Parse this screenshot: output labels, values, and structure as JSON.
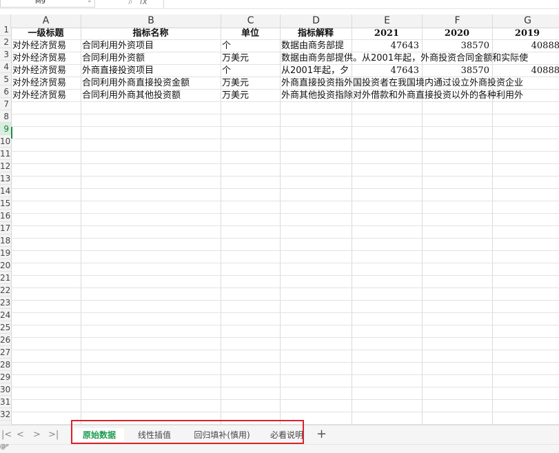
{
  "toolbar": {
    "cell_ref": "M9",
    "search_icon": "🔍",
    "fx_label": "fx"
  },
  "columns": [
    {
      "label": "A"
    },
    {
      "label": "B"
    },
    {
      "label": "C"
    },
    {
      "label": "D"
    },
    {
      "label": "E"
    },
    {
      "label": "F"
    },
    {
      "label": "G"
    }
  ],
  "rows": [
    "1",
    "2",
    "3",
    "4",
    "5",
    "6",
    "7",
    "8",
    "9",
    "10",
    "11",
    "12",
    "13",
    "14",
    "15",
    "16",
    "17",
    "18",
    "19",
    "20",
    "21",
    "22",
    "23",
    "24",
    "25",
    "26",
    "27",
    "28",
    "29",
    "30",
    "31",
    "32"
  ],
  "table": {
    "header": [
      "一级标题",
      "指标名称",
      "单位",
      "指标解释",
      "2021",
      "2020",
      "2019"
    ],
    "data": [
      [
        "对外经济贸易",
        "合同利用外资项目",
        "个",
        "数据由商务部提",
        "47643",
        "38570",
        "40888"
      ],
      [
        "对外经济贸易",
        "合同利用外资额",
        "万美元",
        "数据由商务部提供。从2001年起，外商投资合同金额和实际使",
        "",
        "",
        ""
      ],
      [
        "对外经济贸易",
        "外商直接投资项目",
        "个",
        "从2001年起，夕",
        "47643",
        "38570",
        "40888"
      ],
      [
        "对外经济贸易",
        "合同利用外商直接投资金额",
        "万美元",
        "外商直接投资指外国投资者在我国境内通过设立外商投资企业",
        "",
        "",
        ""
      ],
      [
        "对外经济贸易",
        "合同利用外商其他投资额",
        "万美元",
        "外商其他投资指除对外借款和外商直接投资以外的各种利用外",
        "",
        "",
        ""
      ]
    ]
  },
  "sheets": [
    {
      "label": "原始数据",
      "active": true
    },
    {
      "label": "线性插值",
      "active": false
    },
    {
      "label": "回归填补(慎用)",
      "active": false
    },
    {
      "label": "必看说明",
      "active": false
    }
  ],
  "nav": {
    "first": "|<",
    "prev": "<",
    "next": ">",
    "last": ">|"
  },
  "add_sheet": "+",
  "status": {
    "icon": "@ᵖ"
  },
  "colors": {
    "accent": "#1a9b50",
    "highlight": "#d8232a"
  }
}
